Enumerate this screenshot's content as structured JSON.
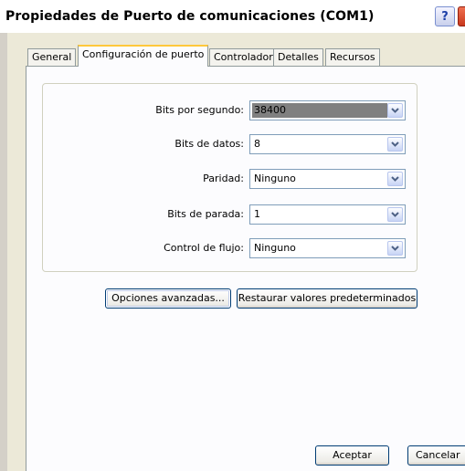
{
  "window": {
    "title": "Propiedades de Puerto de comunicaciones (COM1)",
    "help_glyph": "?"
  },
  "tabs": [
    {
      "label": "General",
      "active": false
    },
    {
      "label": "Configuración de puerto",
      "active": true
    },
    {
      "label": "Controlador",
      "active": false
    },
    {
      "label": "Detalles",
      "active": false
    },
    {
      "label": "Recursos",
      "active": false
    }
  ],
  "port_settings": {
    "bits_per_second": {
      "label": "Bits por segundo:",
      "value": "38400"
    },
    "data_bits": {
      "label": "Bits de datos:",
      "value": "8"
    },
    "parity": {
      "label": "Paridad:",
      "value": "Ninguno"
    },
    "stop_bits": {
      "label": "Bits de parada:",
      "value": "1"
    },
    "flow_control": {
      "label": "Control de flujo:",
      "value": "Ninguno"
    }
  },
  "buttons": {
    "advanced": "Opciones avanzadas...",
    "restore_defaults": "Restaurar valores predeterminados",
    "ok": "Aceptar",
    "cancel": "Cancelar"
  },
  "icons": {
    "dropdown": "chevron-down-icon",
    "help": "help-icon",
    "close": "close-icon"
  },
  "colors": {
    "dialog_bg": "#ECE9D8",
    "panel_bg": "#FCFCFE",
    "active_tab_accent": "#FFC83C",
    "selection_gray": "#808080"
  }
}
